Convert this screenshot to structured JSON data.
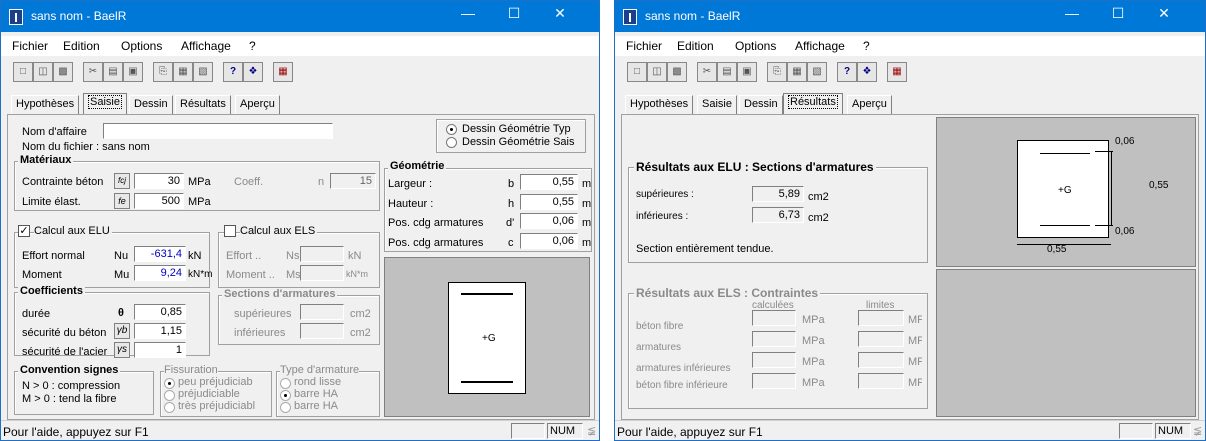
{
  "window_title": "sans nom - BaelR",
  "menu": [
    "Fichier",
    "Edition",
    "Options",
    "Affichage",
    "?"
  ],
  "tabs": [
    "Hypothèses",
    "Saisie",
    "Dessin",
    "Résultats",
    "Aperçu"
  ],
  "status": {
    "help": "Pour l'aide, appuyez sur F1",
    "num": "NUM"
  },
  "saisie": {
    "nom_affaire_label": "Nom d'affaire",
    "nom_affaire_value": "",
    "nom_fichier": "Nom du fichier : sans nom",
    "radio1": "Dessin Géométrie Typ",
    "radio2": "Dessin Géométrie Sais",
    "materiaux": {
      "title": "Matériaux",
      "contrainte_label": "Contrainte béton",
      "fcj_sym": "fcj",
      "fcj": "30",
      "mpa1": "MPa",
      "coeff": "Coeff.",
      "n": "n",
      "n_value": "15",
      "limite_label": "Limite élast.",
      "fe_sym": "fe",
      "fe": "500",
      "mpa2": "MPa"
    },
    "geometrie": {
      "title": "Géométrie",
      "largeur": "Largeur :",
      "b": "b",
      "b_value": "0,55",
      "hauteur": "Hauteur :",
      "h": "h",
      "h_value": "0,55",
      "pos1": "Pos. cdg armatures",
      "d": "d'",
      "d_value": "0,06",
      "pos2": "Pos. cdg armatures",
      "c": "c",
      "c_value": "0,06",
      "unit": "m"
    },
    "elu": {
      "label": "Calcul aux ELU",
      "effort_label": "Effort normal",
      "nu": "Nu",
      "nu_value": "-631,4",
      "nu_unit": "kN",
      "moment_label": "Moment",
      "mu": "Mu",
      "mu_value": "9,24",
      "mu_unit": "kN*m"
    },
    "els": {
      "label": "Calcul aux ELS",
      "effort": "Effort ..",
      "ns": "Ns",
      "ns_unit": "kN",
      "moment": "Moment ..",
      "ms": "Ms",
      "ms_unit": "kN*m",
      "sections_title": "Sections d'armatures",
      "sup": "supérieures",
      "inf": "inférieures",
      "cm2": "cm2"
    },
    "coefficients": {
      "title": "Coefficients",
      "duree": "durée",
      "theta": "θ",
      "duree_value": "0,85",
      "beton": "sécurité du béton",
      "gb": "γb",
      "beton_value": "1,15",
      "acier": "sécurité de l'acier",
      "gs": "γs",
      "acier_value": "1"
    },
    "convention": {
      "title": "Convention signes",
      "line1": "N > 0 : compression",
      "line2": "M > 0 : tend la fibre"
    },
    "fissuration": {
      "title": "Fissuration",
      "o1": "peu préjudiciab",
      "o2": "préjudiciable",
      "o3": "très préjudiciabl"
    },
    "armature": {
      "title": "Type d'armature",
      "o1": "rond lisse",
      "o2": "barre HA",
      "o3": "barre HA"
    },
    "g_label": "+G"
  },
  "resultats": {
    "elu_title": "Résultats aux ELU : Sections d'armatures",
    "sup": "supérieures :",
    "sup_value": "5,89",
    "inf": "inférieures :",
    "inf_value": "6,73",
    "cm2": "cm2",
    "section_text": "Section entièrement tendue.",
    "els_title": "Résultats aux ELS : Contraintes",
    "calculees": "calculées",
    "limites": "limites",
    "rows": [
      "béton fibre",
      "armatures",
      "armatures inférieures",
      "béton fibre inférieure"
    ],
    "mpa": "MPa",
    "dim_top": "0,06",
    "dim_side": "0,55",
    "dim_bottom": "0,06",
    "dim_width": "0,55",
    "g_label": "+G"
  },
  "icons": [
    "new-icon",
    "open-icon",
    "save-icon",
    "cut-icon",
    "copy-icon",
    "paste-icon",
    "print-icon",
    "print-preview-icon",
    "calc-icon",
    "help-icon",
    "context-help-icon",
    "calculator-icon"
  ]
}
